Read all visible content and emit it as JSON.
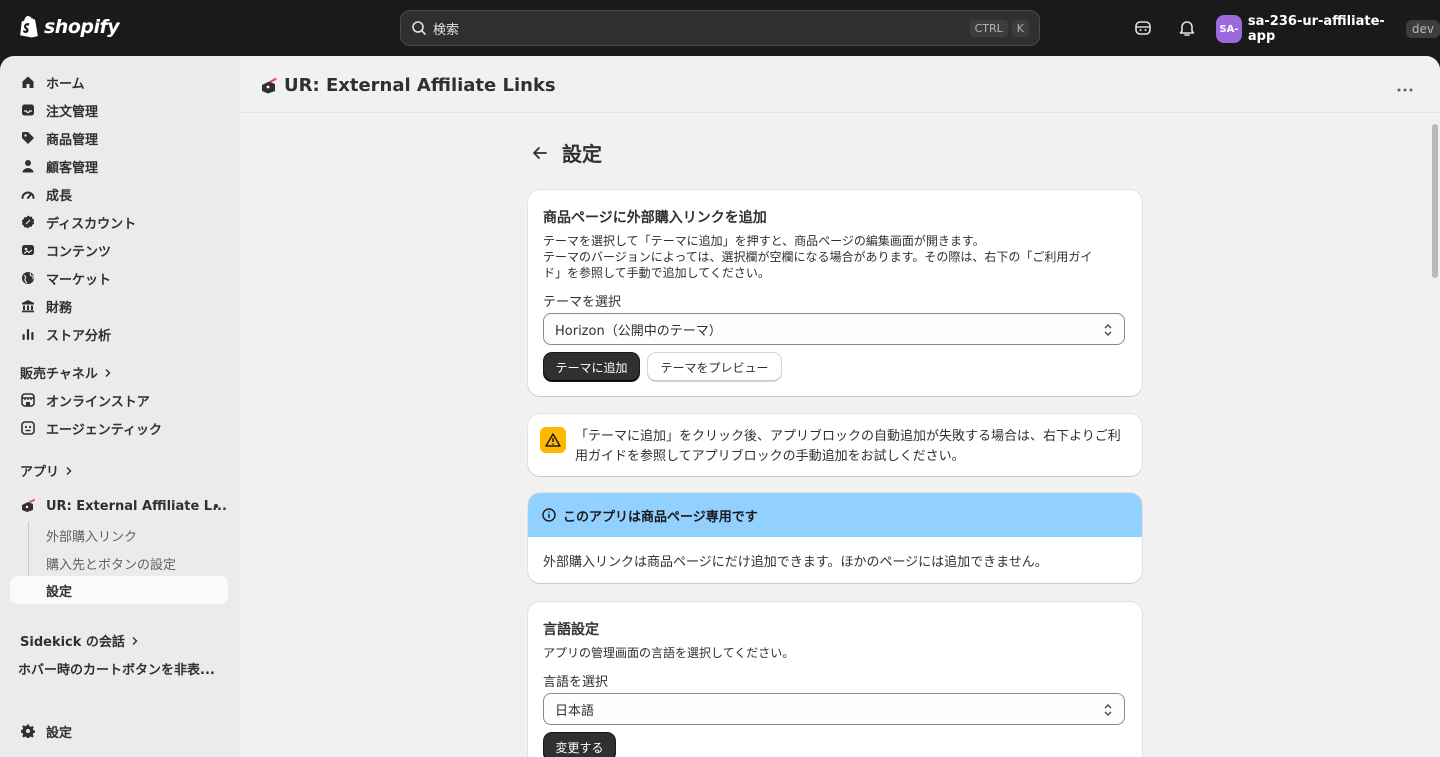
{
  "topbar": {
    "brand": "shopify",
    "search_placeholder": "検索",
    "shortcut_ctrl": "CTRL",
    "shortcut_key": "K",
    "avatar_initials": "SA-",
    "store_name": "sa-236-ur-affiliate-app",
    "env_badge": "dev",
    "avatar_color": "#9c6ade"
  },
  "sidebar": {
    "items": [
      {
        "label": "ホーム",
        "icon": "home-icon"
      },
      {
        "label": "注文管理",
        "icon": "inbox-icon"
      },
      {
        "label": "商品管理",
        "icon": "tag-icon"
      },
      {
        "label": "顧客管理",
        "icon": "person-icon"
      },
      {
        "label": "成長",
        "icon": "gauge-icon"
      },
      {
        "label": "ディスカウント",
        "icon": "discount-icon"
      },
      {
        "label": "コンテンツ",
        "icon": "content-icon"
      },
      {
        "label": "マーケット",
        "icon": "globe-icon"
      },
      {
        "label": "財務",
        "icon": "bank-icon"
      },
      {
        "label": "ストア分析",
        "icon": "chart-icon"
      }
    ],
    "sales_channels_label": "販売チャネル",
    "channels": [
      {
        "label": "オンラインストア",
        "icon": "store-icon"
      },
      {
        "label": "エージェンティック",
        "icon": "agent-icon"
      }
    ],
    "apps_label": "アプリ",
    "app_name": "UR: External Affiliate L...",
    "app_subitems": [
      "外部購入リンク",
      "購入先とボタンの設定"
    ],
    "app_active_item": "設定",
    "sidekick_label": "Sidekick の会話",
    "sidekick_convo": "ホバー時のカートボタンを非表...",
    "settings_label": "設定"
  },
  "main": {
    "app_title": "UR: External Affiliate Links",
    "page_title": "設定",
    "card_theme": {
      "heading": "商品ページに外部購入リンクを追加",
      "desc_line1": "テーマを選択して「テーマに追加」を押すと、商品ページの編集画面が開きます。",
      "desc_line2": "テーマのバージョンによっては、選択欄が空欄になる場合があります。その際は、右下の「ご利用ガイ",
      "desc_line3": "ド」を参照して手動で追加してください。",
      "select_label": "テーマを選択",
      "select_value": "Horizon（公開中のテーマ）",
      "add_button": "テーマに追加",
      "preview_button": "テーマをプレビュー"
    },
    "warning": {
      "line1": "「テーマに追加」をクリック後、アプリブロックの自動追加が失敗する場合は、右下よりご利",
      "line2": "用ガイドを参照してアプリブロックの手動追加をお試しください。",
      "color": "#ffb800"
    },
    "info": {
      "title": "このアプリは商品ページ専用です",
      "body": "外部購入リンクは商品ページにだけ追加できます。ほかのページには追加できません。",
      "color": "#91d0ff"
    },
    "language": {
      "heading": "言語設定",
      "desc": "アプリの管理画面の言語を選択してください。",
      "select_label": "言語を選択",
      "select_value": "日本語",
      "change_button": "変更する"
    }
  }
}
